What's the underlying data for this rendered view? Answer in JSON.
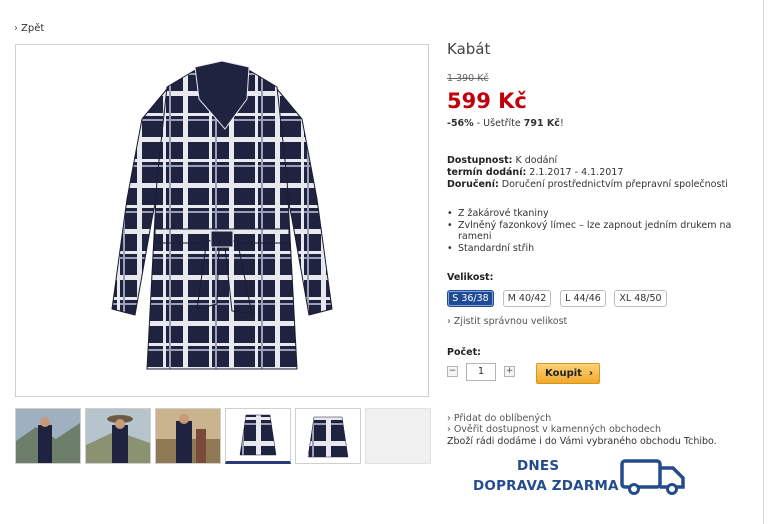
{
  "nav": {
    "back_label": "Zpět"
  },
  "product": {
    "title": "Kabát",
    "old_price": "1 390 Kč",
    "price": "599 Kč",
    "discount": "-56%",
    "savings_label": "- Ušetříte",
    "savings_amount": "791 Kč",
    "savings_end": "!"
  },
  "availability": {
    "availability_label": "Dostupnost:",
    "availability_value": "K dodání",
    "delivery_date_label": "termín dodání:",
    "delivery_date_value": "2.1.2017 - 4.1.2017",
    "shipping_label": "Doručení:",
    "shipping_value": "Doručení prostřednictvím přepravní společnosti"
  },
  "features": [
    "Z žakárové tkaniny",
    "Zvlněný fazonkový límec – lze zapnout jedním drukem na",
    "rameni",
    "Standardní střih"
  ],
  "sizes": {
    "label": "Velikost:",
    "options": [
      "S 36/38",
      "M 40/42",
      "L 44/46",
      "XL 48/50"
    ],
    "selected": "S 36/38",
    "size_guide_link": "Zjistit správnou velikost"
  },
  "quantity": {
    "label": "Počet:",
    "value": "1",
    "minus": "−",
    "plus": "+"
  },
  "buy": {
    "label": "Koupit",
    "arrow": "›"
  },
  "links": {
    "favorites": "Přidat do oblíbených",
    "check_store": "Ověřit dostupnost v kamenných obchodech",
    "store_delivery_note": "Zboží rádi dodáme i do Vámi vybraného obchodu Tchibo."
  },
  "banner": {
    "line1": "DNES",
    "line2": "DOPRAVA ZDARMA",
    "icon": "truck-icon"
  },
  "colors": {
    "price_red": "#c0000b",
    "selected_size": "#1f4a95",
    "buy_button": "#f0a92c",
    "delivery_blue": "#244c8c",
    "coat_navy": "#1f2340"
  },
  "icons": {
    "chevron": "›"
  }
}
